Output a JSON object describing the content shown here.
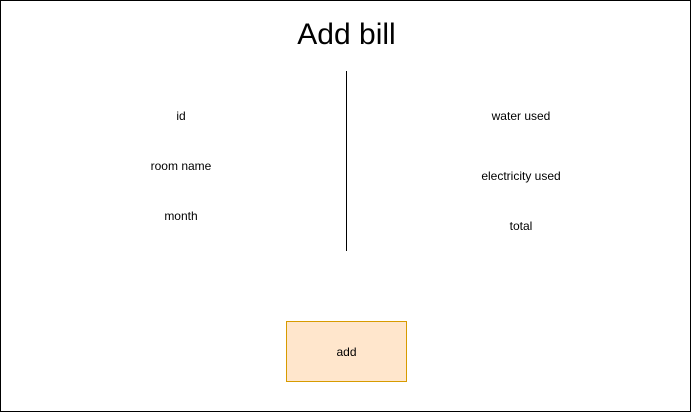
{
  "page": {
    "title": "Add bill"
  },
  "left_fields": {
    "id": "id",
    "room_name": "room name",
    "month": "month"
  },
  "right_fields": {
    "water_used": "water used",
    "electricity_used": "electricity used",
    "total": "total"
  },
  "actions": {
    "add_label": "add"
  },
  "colors": {
    "button_fill": "#ffe6cc",
    "button_border": "#d79b00",
    "frame_border": "#000000"
  }
}
